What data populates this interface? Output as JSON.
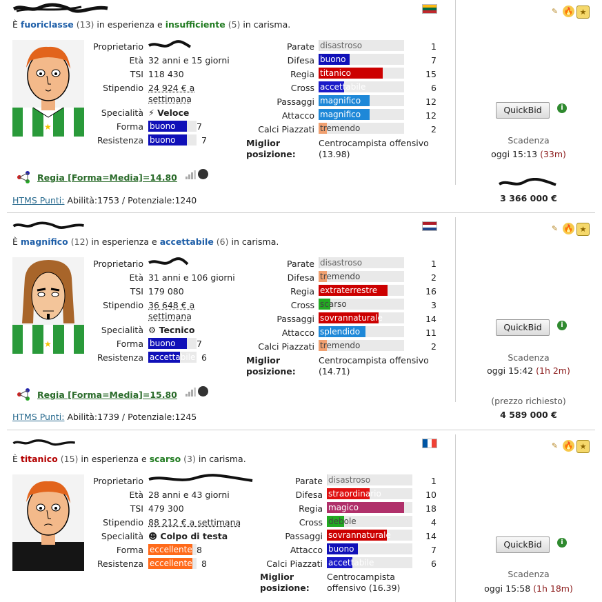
{
  "players": [
    {
      "summary": {
        "pre": "È",
        "exp_word": "fuoriclasse",
        "exp_level": "(13)",
        "mid": "in esperienza e",
        "char_word": "insufficiente",
        "char_level": "(5)",
        "post": "in carisma."
      },
      "info": {
        "owner_label": "Proprietario",
        "age_label": "Età",
        "age": "32 anni e 15 giorni",
        "tsi_label": "TSI",
        "tsi": "118 430",
        "salary_label": "Stipendio",
        "salary": "24 924 € a settimana",
        "spec_label": "Specialità",
        "spec": "Veloce",
        "form_label": "Forma",
        "form": "buono",
        "form_level": "7",
        "stamina_label": "Resistenza",
        "stamina": "buono",
        "stamina_level": "7"
      },
      "skills": [
        {
          "label": "Parate",
          "word": "disastroso",
          "level": "1"
        },
        {
          "label": "Difesa",
          "word": "buono",
          "level": "7"
        },
        {
          "label": "Regia",
          "word": "titanico",
          "level": "15"
        },
        {
          "label": "Cross",
          "word": "accettabile",
          "level": "6"
        },
        {
          "label": "Passaggi",
          "word": "magnifico",
          "level": "12"
        },
        {
          "label": "Attacco",
          "word": "magnifico",
          "level": "12"
        },
        {
          "label": "Calci Piazzati",
          "word": "tremendo",
          "level": "2"
        }
      ],
      "best_label": "Miglior posizione:",
      "best_value": "Centrocampista offensivo (13.98)",
      "rating": "Regia [Forma=Media]=14.80",
      "htms": {
        "label": "HTMS Punti:",
        "value": "Abilità:1753 / Potenziale:1240"
      },
      "quickbid": "QuickBid",
      "deadline_label": "Scadenza",
      "deadline": "oggi 15:13",
      "remaining": "(33m)",
      "price_note": "",
      "price": "3 366 000 €",
      "flag": "lithuania"
    },
    {
      "summary": {
        "pre": "È",
        "exp_word": "magnifico",
        "exp_level": "(12)",
        "mid": "in esperienza e",
        "char_word": "accettabile",
        "char_level": "(6)",
        "post": "in carisma."
      },
      "info": {
        "owner_label": "Proprietario",
        "age_label": "Età",
        "age": "31 anni e 106 giorni",
        "tsi_label": "TSI",
        "tsi": "179 080",
        "salary_label": "Stipendio",
        "salary": "36 648 € a settimana",
        "spec_label": "Specialità",
        "spec": "Tecnico",
        "form_label": "Forma",
        "form": "buono",
        "form_level": "7",
        "stamina_label": "Resistenza",
        "stamina": "accettabile",
        "stamina_level": "6"
      },
      "skills": [
        {
          "label": "Parate",
          "word": "disastroso",
          "level": "1"
        },
        {
          "label": "Difesa",
          "word": "tremendo",
          "level": "2"
        },
        {
          "label": "Regia",
          "word": "extraterrestre",
          "level": "16"
        },
        {
          "label": "Cross",
          "word": "scarso",
          "level": "3"
        },
        {
          "label": "Passaggi",
          "word": "sovrannaturale",
          "level": "14"
        },
        {
          "label": "Attacco",
          "word": "splendido",
          "level": "11"
        },
        {
          "label": "Calci Piazzati",
          "word": "tremendo",
          "level": "2"
        }
      ],
      "best_label": "Miglior posizione:",
      "best_value": "Centrocampista offensivo (14.71)",
      "rating": "Regia [Forma=Media]=15.80",
      "htms": {
        "label": "HTMS Punti:",
        "value": "Abilità:1739 / Potenziale:1245"
      },
      "quickbid": "QuickBid",
      "deadline_label": "Scadenza",
      "deadline": "oggi 15:42",
      "remaining": "(1h 2m)",
      "price_note": "(prezzo richiesto)",
      "price": "4 589 000 €",
      "flag": "netherlands"
    },
    {
      "summary": {
        "pre": "È",
        "exp_word": "titanico",
        "exp_level": "(15)",
        "mid": "in esperienza e",
        "char_word": "scarso",
        "char_level": "(3)",
        "post": "in carisma."
      },
      "info": {
        "owner_label": "Proprietario",
        "age_label": "Età",
        "age": "28 anni e 43 giorni",
        "tsi_label": "TSI",
        "tsi": "479 300",
        "salary_label": "Stipendio",
        "salary": "88 212 € a settimana",
        "spec_label": "Specialità",
        "spec": "Colpo di testa",
        "form_label": "Forma",
        "form": "eccellente",
        "form_level": "8",
        "stamina_label": "Resistenza",
        "stamina": "eccellente",
        "stamina_level": "8"
      },
      "skills": [
        {
          "label": "Parate",
          "word": "disastroso",
          "level": "1"
        },
        {
          "label": "Difesa",
          "word": "straordinario",
          "level": "10"
        },
        {
          "label": "Regia",
          "word": "magico",
          "level": "18"
        },
        {
          "label": "Cross",
          "word": "debole",
          "level": "4"
        },
        {
          "label": "Passaggi",
          "word": "sovrannaturale",
          "level": "14"
        },
        {
          "label": "Attacco",
          "word": "buono",
          "level": "7"
        },
        {
          "label": "Calci Piazzati",
          "word": "accettabile",
          "level": "6"
        }
      ],
      "best_label": "Miglior posizione:",
      "best_value": "Centrocampista offensivo (16.39)",
      "quickbid": "QuickBid",
      "deadline_label": "Scadenza",
      "deadline": "oggi 15:58",
      "remaining": "(1h 18m)",
      "flag": "france"
    }
  ],
  "colors": {
    "level_1": "#e0e0e0",
    "level_2": "#f0a070",
    "level_3": "#22aa22",
    "level_6": "#1a1ac8",
    "level_7": "#1010b8",
    "level_8": "#ff6a1a",
    "level_high_red": "#cc0000",
    "magnifico": "#1e88d8",
    "magico": "#b0306a"
  }
}
